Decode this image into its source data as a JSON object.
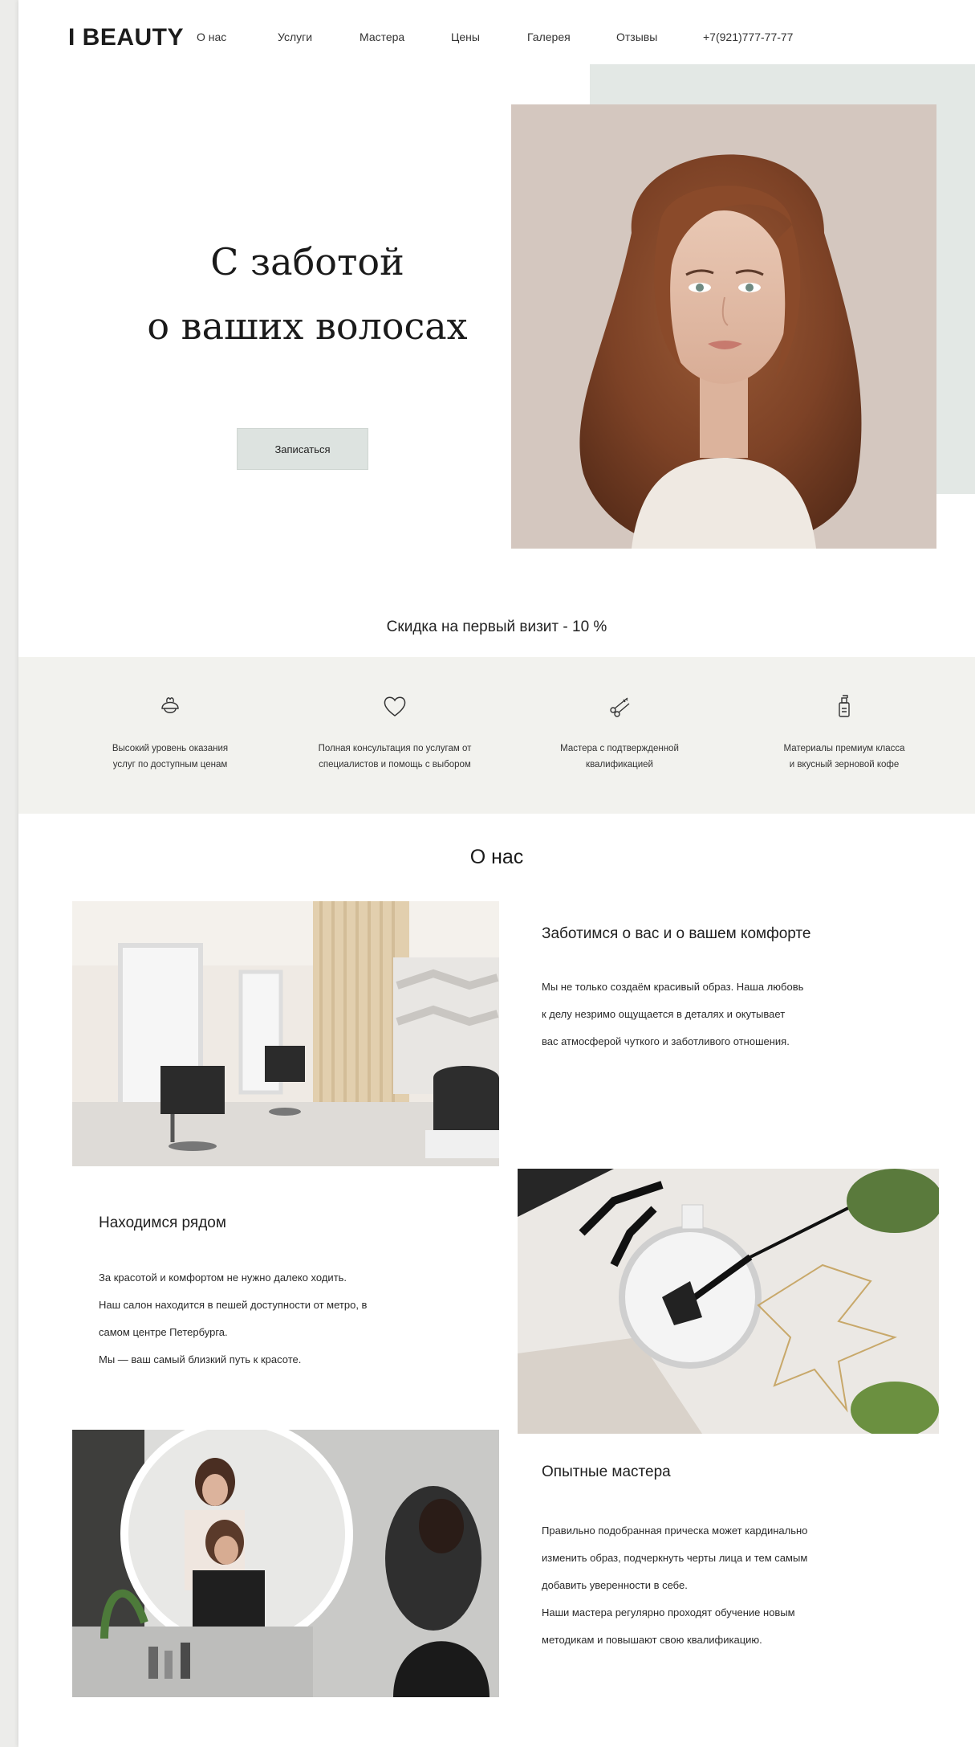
{
  "header": {
    "logo": "I BEAUTY",
    "nav": [
      "О нас",
      "Услуги",
      "Мастера",
      "Цены",
      "Галерея",
      "Отзывы"
    ],
    "phone": "+7(921)777-77-77"
  },
  "hero": {
    "title_line1": "С заботой",
    "title_line2": "о ваших волосах",
    "cta_label": "Записаться"
  },
  "promo": {
    "text": "Скидка на первый визит - 10 %"
  },
  "features": [
    {
      "icon": "hair-care-icon",
      "line1": "Высокий уровень оказания",
      "line2": "услуг по доступным ценам"
    },
    {
      "icon": "heart-icon",
      "line1": "Полная консультация по услугам от",
      "line2": "специалистов и помощь с выбором"
    },
    {
      "icon": "scissors-comb-icon",
      "line1": "Мастера с подтвержденной",
      "line2": "квалификацией"
    },
    {
      "icon": "bottle-icon",
      "line1": "Материалы премиум класса",
      "line2": "и вкусный зерновой кофе"
    }
  ],
  "about": {
    "title": "О нас",
    "block1": {
      "heading": "Заботимся о вас и о вашем комфорте",
      "lines": [
        "Мы не только создаём красивый образ. Наша любовь",
        "к делу незримо ощущается в деталях и окутывает",
        "вас атмосферой чуткого и заботливого отношения."
      ]
    },
    "block2": {
      "heading": "Находимся рядом",
      "lines": [
        "За красотой и комфортом не нужно далеко ходить.",
        "Наш салон находится в пешей доступности от метро, в",
        "самом центре Петербурга.",
        "Мы — ваш самый близкий путь к красоте."
      ]
    },
    "block3": {
      "heading": "Опытные мастера",
      "lines": [
        "Правильно подобранная прическа может кардинально",
        "изменить образ, подчеркнуть черты лица и тем самым",
        "добавить уверенности в себе.",
        "Наши мастера регулярно проходят обучение новым",
        "методикам и повышают свою квалификацию."
      ]
    }
  },
  "colors": {
    "accent_bg": "#e3e8e5",
    "button_bg": "#dde3e0",
    "feature_band": "#f2f2ee",
    "text": "#222222"
  }
}
